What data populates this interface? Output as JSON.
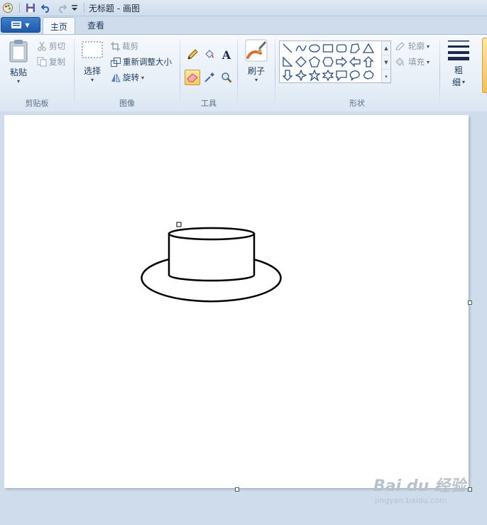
{
  "window": {
    "title": "无标题 - 画图"
  },
  "tabs": {
    "home": "主页",
    "view": "查看"
  },
  "ribbon": {
    "clipboard": {
      "label": "剪贴板",
      "paste": "粘贴",
      "cut": "剪切",
      "copy": "复制"
    },
    "image": {
      "label": "图像",
      "select": "选择",
      "crop": "裁剪",
      "resize": "重新调整大小",
      "rotate": "旋转"
    },
    "tools": {
      "label": "工具"
    },
    "brushes": {
      "label": "刷子"
    },
    "shapes": {
      "label": "形状",
      "outline": "轮廓",
      "fill": "填充"
    },
    "size": {
      "label_1": "粗",
      "label_2": "细"
    }
  },
  "watermark": {
    "main": "Bai du 经验",
    "sub": "jingyan.baidu.com"
  },
  "icons": [
    "paint-app-icon",
    "save-icon",
    "undo-icon",
    "redo-icon",
    "customize-icon",
    "file-menu-icon",
    "paste-icon",
    "scissors-icon",
    "copy-icon",
    "select-icon",
    "crop-icon",
    "resize-icon",
    "rotate-icon",
    "pencil-icon",
    "fill-bucket-icon",
    "text-icon",
    "eraser-icon",
    "color-picker-icon",
    "magnifier-icon",
    "brush-icon",
    "outline-icon",
    "fill-icon",
    "size-lines-icon"
  ]
}
